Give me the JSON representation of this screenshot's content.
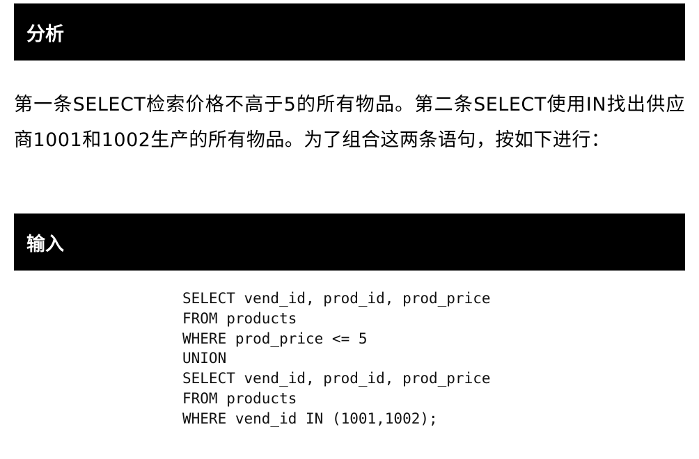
{
  "sections": {
    "analysis": {
      "title": "分析",
      "text": "第一条SELECT检索价格不高于5的所有物品。第二条SELECT使用IN找出供应商1001和1002生产的所有物品。为了组合这两条语句，按如下进行："
    },
    "input": {
      "title": "输入",
      "code_lines": [
        "SELECT vend_id, prod_id, prod_price",
        "FROM products",
        "WHERE prod_price <= 5",
        "UNION",
        "SELECT vend_id, prod_id, prod_price",
        "FROM products",
        "WHERE vend_id IN (1001,1002);"
      ]
    }
  }
}
